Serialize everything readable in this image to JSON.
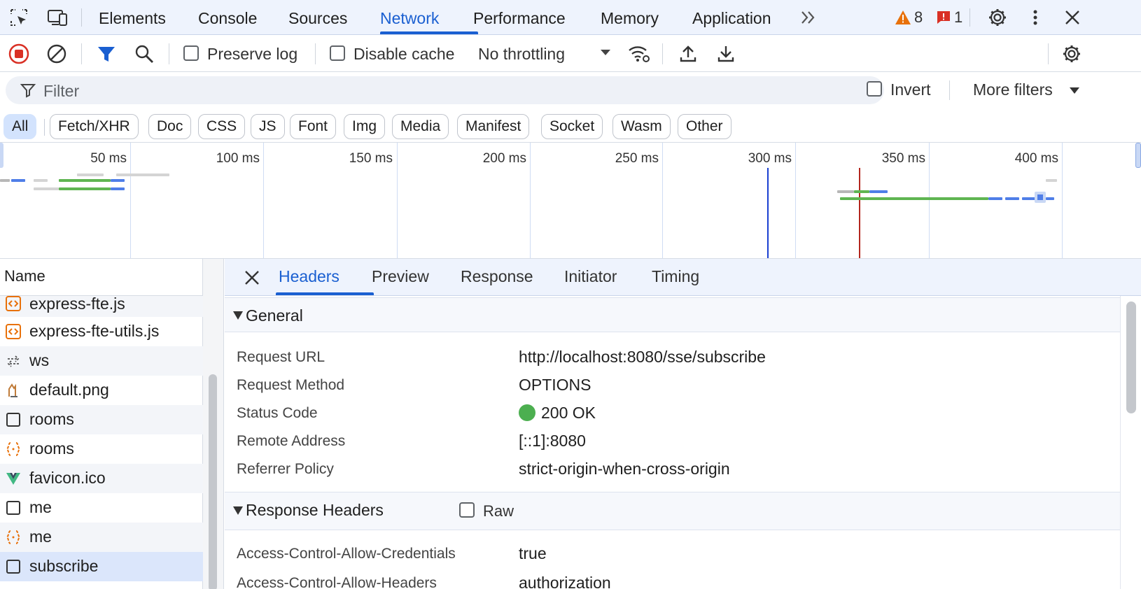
{
  "top_tabs": [
    "Elements",
    "Console",
    "Sources",
    "Network",
    "Performance",
    "Memory",
    "Application"
  ],
  "active_tab": "Network",
  "warnings_count": "8",
  "issues_count": "1",
  "toolbar": {
    "preserve_log": "Preserve log",
    "disable_cache": "Disable cache",
    "throttling": "No throttling"
  },
  "filter": {
    "placeholder": "Filter",
    "invert": "Invert",
    "more_filters": "More filters"
  },
  "type_filters": [
    "All",
    "Fetch/XHR",
    "Doc",
    "CSS",
    "JS",
    "Font",
    "Img",
    "Media",
    "Manifest",
    "Socket",
    "Wasm",
    "Other"
  ],
  "timeline": {
    "ticks": [
      "50 ms",
      "100 ms",
      "150 ms",
      "200 ms",
      "250 ms",
      "300 ms",
      "350 ms",
      "400 ms"
    ]
  },
  "request_list": {
    "header": "Name",
    "rows": [
      {
        "name": "express-fte.js",
        "icon": "script-icon"
      },
      {
        "name": "express-fte-utils.js",
        "icon": "script-icon"
      },
      {
        "name": "ws",
        "icon": "websocket-icon"
      },
      {
        "name": "default.png",
        "icon": "image-icon"
      },
      {
        "name": "rooms",
        "icon": "document-icon"
      },
      {
        "name": "rooms",
        "icon": "json-icon"
      },
      {
        "name": "favicon.ico",
        "icon": "vue-icon"
      },
      {
        "name": "me",
        "icon": "document-icon"
      },
      {
        "name": "me",
        "icon": "json-icon"
      },
      {
        "name": "subscribe",
        "icon": "document-icon"
      }
    ],
    "selected": "subscribe"
  },
  "detail_tabs": [
    "Headers",
    "Preview",
    "Response",
    "Initiator",
    "Timing"
  ],
  "active_detail_tab": "Headers",
  "general": {
    "title": "General",
    "rows": [
      {
        "key": "Request URL",
        "value": "http://localhost:8080/sse/subscribe"
      },
      {
        "key": "Request Method",
        "value": "OPTIONS"
      },
      {
        "key": "Status Code",
        "value": "200 OK"
      },
      {
        "key": "Remote Address",
        "value": "[::1]:8080"
      },
      {
        "key": "Referrer Policy",
        "value": "strict-origin-when-cross-origin"
      }
    ]
  },
  "response_headers": {
    "title": "Response Headers",
    "raw_label": "Raw",
    "rows": [
      {
        "key": "Access-Control-Allow-Credentials",
        "value": "true"
      },
      {
        "key": "Access-Control-Allow-Headers",
        "value": "authorization"
      }
    ]
  },
  "colors": {
    "accent": "#1a5fd1",
    "status_ok": "#4caf50",
    "error_red": "#d93025",
    "warning_orange": "#e8710a"
  }
}
